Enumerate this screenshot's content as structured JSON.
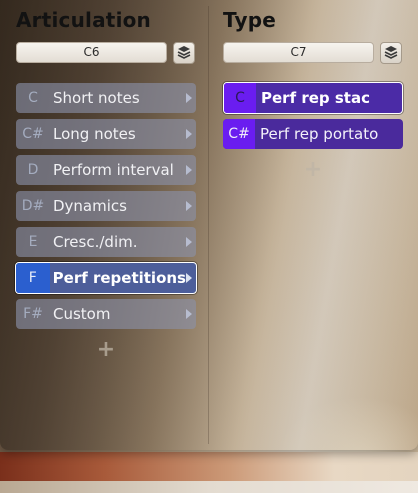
{
  "articulation": {
    "title": "Articulation",
    "key_field": "C6",
    "items": [
      {
        "key": "C",
        "label": "Short notes"
      },
      {
        "key": "C#",
        "label": "Long notes"
      },
      {
        "key": "D",
        "label": "Perform interval"
      },
      {
        "key": "D#",
        "label": "Dynamics"
      },
      {
        "key": "E",
        "label": "Cresc./dim."
      },
      {
        "key": "F",
        "label": "Perf repetitions"
      },
      {
        "key": "F#",
        "label": "Custom"
      }
    ],
    "selected_index": 5,
    "add_label": "+"
  },
  "type": {
    "title": "Type",
    "key_field": "C7",
    "items": [
      {
        "key": "C",
        "label": "Perf rep stac"
      },
      {
        "key": "C#",
        "label": "Perf rep portato"
      }
    ],
    "selected_index": 0,
    "add_label": "+"
  },
  "icons": {
    "layers": "layers-icon",
    "arrow": "chevron-right-icon",
    "add": "plus-icon"
  },
  "colors": {
    "selected_articulation_key": "#2b5fcf",
    "type_row": "#4a2a9c",
    "type_key": "#6a1df0"
  }
}
